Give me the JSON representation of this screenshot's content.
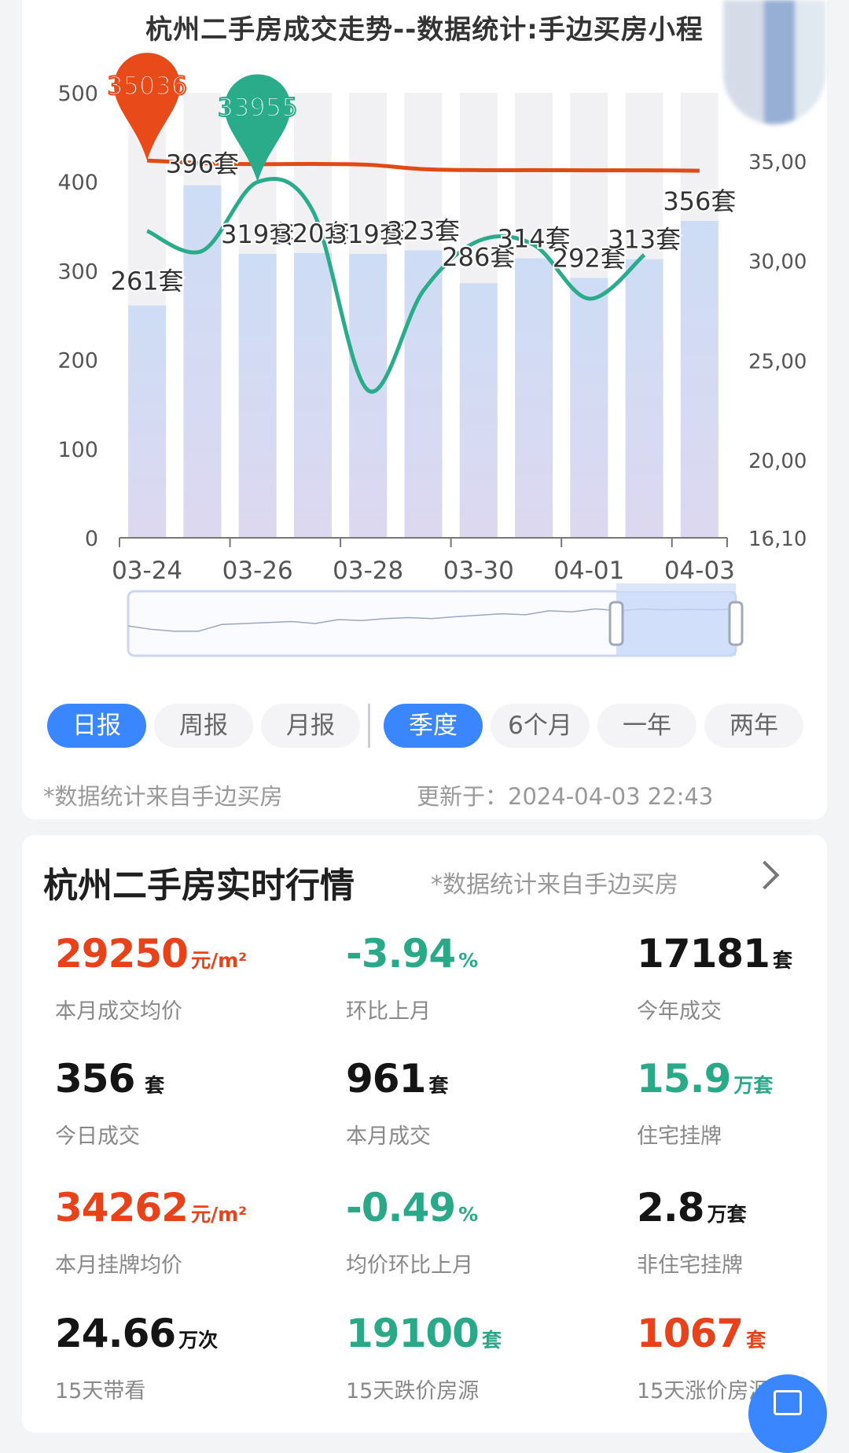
{
  "chart_data": {
    "title": "杭州二手房成交走势--数据统计:手边买房小程",
    "type": "bar",
    "categories": [
      "03-24",
      "03-25",
      "03-26",
      "03-27",
      "03-28",
      "03-29",
      "03-30",
      "03-31",
      "04-01",
      "04-02",
      "04-03"
    ],
    "x_tick_labels": [
      "03-24",
      "03-26",
      "03-28",
      "03-30",
      "04-01",
      "04-03"
    ],
    "y_left_ticks": [
      "500",
      "400",
      "300",
      "200",
      "100",
      "0"
    ],
    "y_left_range": [
      0,
      500
    ],
    "y_right_ticks": [
      "35,00",
      "30,00",
      "25,00",
      "20,00",
      "16,10"
    ],
    "y_right_range": [
      16100,
      35000
    ],
    "bar_unit": "套",
    "series": [
      {
        "type": "bar",
        "values": [
          261,
          396,
          319,
          320,
          319,
          323,
          286,
          314,
          292,
          313,
          356
        ],
        "axis": "left",
        "color": "#c7d5ef"
      },
      {
        "type": "line",
        "values": [
          35036,
          34900,
          34850,
          34860,
          34820,
          34600,
          34550,
          34550,
          34540,
          34540,
          34520
        ],
        "axis": "right",
        "color": "#e04a15"
      },
      {
        "type": "line",
        "values": [
          31500,
          30500,
          33955,
          32500,
          23500,
          28500,
          31000,
          30800,
          28100,
          30300
        ],
        "axis": "right",
        "color": "#2aab8a"
      }
    ],
    "markers": [
      {
        "label": "35036",
        "index": 0,
        "series": 1,
        "color": "#e84a1a"
      },
      {
        "label": "33955",
        "index": 2,
        "series": 2,
        "color": "#2aab8a"
      }
    ],
    "grid": false
  },
  "tabs": {
    "left": [
      {
        "label": "日报",
        "active": true
      },
      {
        "label": "周报",
        "active": false
      },
      {
        "label": "月报",
        "active": false
      }
    ],
    "right": [
      {
        "label": "季度",
        "active": true
      },
      {
        "label": "6个月",
        "active": false
      },
      {
        "label": "一年",
        "active": false
      },
      {
        "label": "两年",
        "active": false
      }
    ]
  },
  "chart_footer": {
    "source": "*数据统计来自手边买房",
    "updated": "更新于：2024-04-03 22:43"
  },
  "market": {
    "title": "杭州二手房实时行情",
    "note": "*数据统计来自手边买房",
    "stats": [
      {
        "value": "29250",
        "unit": "元/m²",
        "label": "本月成交均价",
        "color": "red"
      },
      {
        "value": "-3.94",
        "unit": "%",
        "label": "环比上月",
        "color": "green"
      },
      {
        "value": "17181",
        "unit": "套",
        "label": "今年成交",
        "color": "black"
      },
      {
        "value": "356",
        "unit": " 套",
        "label": "今日成交",
        "color": "black"
      },
      {
        "value": "961",
        "unit": "套",
        "label": "本月成交",
        "color": "black"
      },
      {
        "value": "15.9",
        "unit": "万套",
        "label": "住宅挂牌",
        "color": "green"
      },
      {
        "value": "34262",
        "unit": "元/m²",
        "label": "本月挂牌均价",
        "color": "red"
      },
      {
        "value": "-0.49",
        "unit": "%",
        "label": "均价环比上月",
        "color": "green"
      },
      {
        "value": "2.8",
        "unit": "万套",
        "label": "非住宅挂牌",
        "color": "black"
      },
      {
        "value": "24.66",
        "unit": "万次",
        "label": "15天带看",
        "color": "black"
      },
      {
        "value": "19100",
        "unit": "套",
        "label": "15天跌价房源",
        "color": "green"
      },
      {
        "value": "1067",
        "unit": "套",
        "label": "15天涨价房源",
        "color": "red"
      }
    ]
  }
}
